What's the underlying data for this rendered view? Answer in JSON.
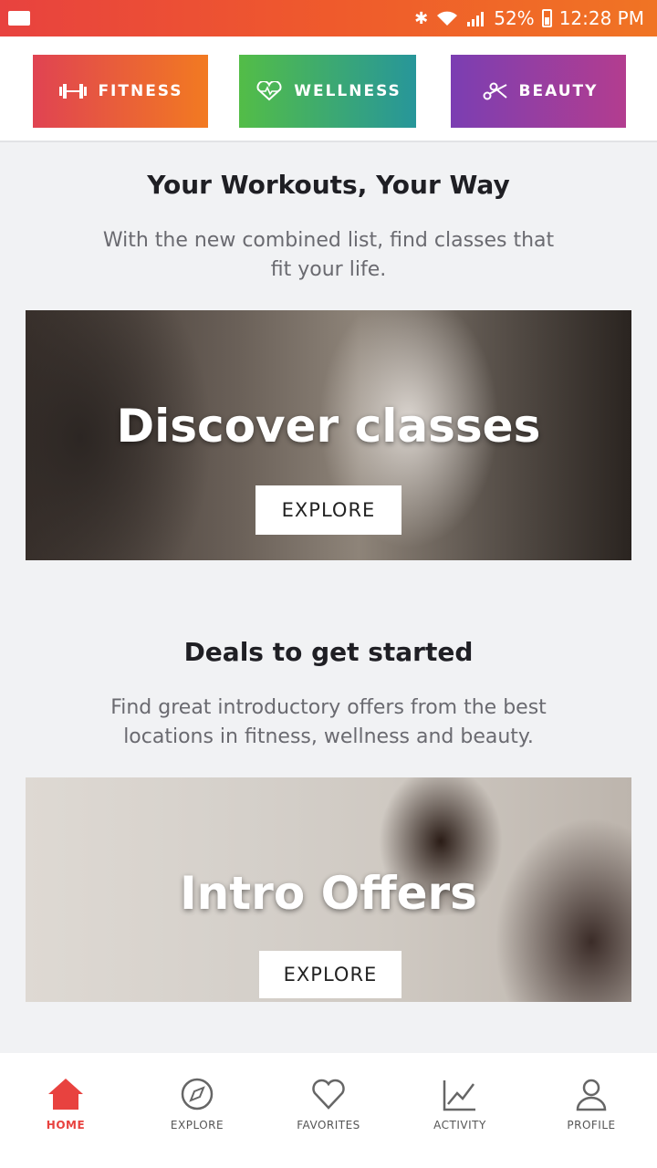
{
  "status_bar": {
    "battery": "52%",
    "time": "12:28 PM"
  },
  "categories": [
    {
      "label": "FITNESS",
      "icon": "dumbbell-icon"
    },
    {
      "label": "WELLNESS",
      "icon": "heart-pulse-icon"
    },
    {
      "label": "BEAUTY",
      "icon": "scissors-icon"
    }
  ],
  "section1": {
    "title": "Your Workouts, Your Way",
    "subtitle": "With the new combined list, find classes that fit your life.",
    "card_title": "Discover classes",
    "button": "EXPLORE"
  },
  "section2": {
    "title": "Deals to get started",
    "subtitle": "Find great introductory offers from the best locations in fitness, wellness and beauty.",
    "card_title": "Intro Offers",
    "button": "EXPLORE"
  },
  "bottom_nav": [
    {
      "label": "HOME",
      "icon": "home-icon",
      "active": true
    },
    {
      "label": "EXPLORE",
      "icon": "compass-icon"
    },
    {
      "label": "FAVORITES",
      "icon": "heart-icon"
    },
    {
      "label": "ACTIVITY",
      "icon": "activity-chart-icon"
    },
    {
      "label": "PROFILE",
      "icon": "profile-icon"
    }
  ],
  "colors": {
    "accent": "#e8423f",
    "fitness": "#f27a21",
    "wellness": "#27969a",
    "beauty": "#7b3eb2"
  }
}
